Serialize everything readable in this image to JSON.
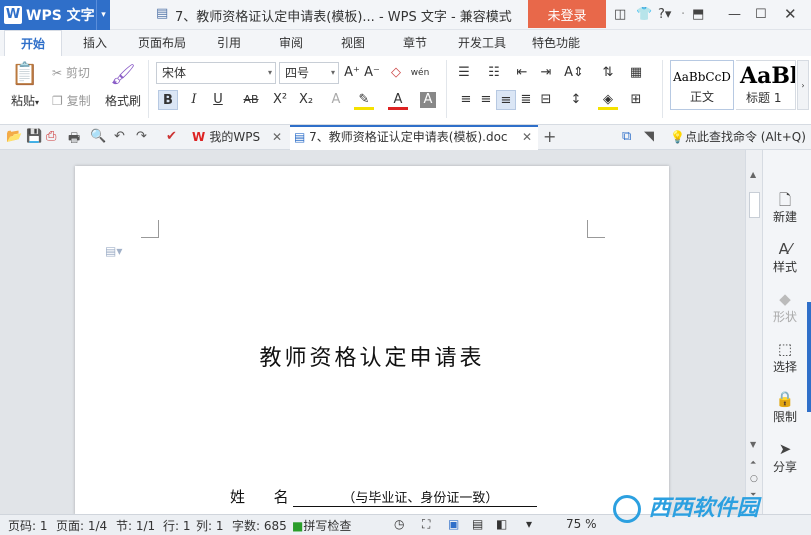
{
  "titlebar": {
    "app_name": "WPS 文字",
    "doc_title": "7、教师资格证认定申请表(模板)... - WPS 文字 - 兼容模式",
    "login": "未登录"
  },
  "ribbon_tabs": [
    "开始",
    "插入",
    "页面布局",
    "引用",
    "审阅",
    "视图",
    "章节",
    "开发工具",
    "特色功能"
  ],
  "ribbon": {
    "paste": "粘贴",
    "cut": "剪切",
    "copy": "复制",
    "format_painter": "格式刷",
    "font_name": "宋体",
    "font_size": "四号",
    "bold": "B",
    "italic": "I",
    "underline": "U",
    "styles": [
      {
        "sample": "AaBbCcD",
        "name": "正文"
      },
      {
        "sample": "AaBl",
        "name": "标题 1"
      }
    ]
  },
  "tabs_bar": {
    "my_wps": "我的WPS",
    "doc_tab": "7、教师资格证认定申请表(模板).doc",
    "find_command": "点此查找命令 (Alt+Q)"
  },
  "document": {
    "heading": "教师资格认定申请表",
    "name_label": "姓      名",
    "name_hint": "（与毕业证、身份证一致）"
  },
  "right_panel": [
    {
      "label": "新建",
      "icon": "new-doc-icon",
      "enabled": true
    },
    {
      "label": "样式",
      "icon": "style-icon",
      "enabled": true
    },
    {
      "label": "形状",
      "icon": "shape-icon",
      "enabled": false
    },
    {
      "label": "选择",
      "icon": "select-icon",
      "enabled": true
    },
    {
      "label": "限制",
      "icon": "restrict-icon",
      "enabled": true
    },
    {
      "label": "分享",
      "icon": "share-icon",
      "enabled": true
    }
  ],
  "statusbar": {
    "page_code": "页码: 1",
    "page": "页面: 1/4",
    "section": "节: 1/1",
    "line": "行: 1",
    "column": "列: 1",
    "word_count": "字数: 685",
    "spell_check": "拼写检查",
    "zoom": "75 %"
  },
  "watermark": "西西软件园"
}
